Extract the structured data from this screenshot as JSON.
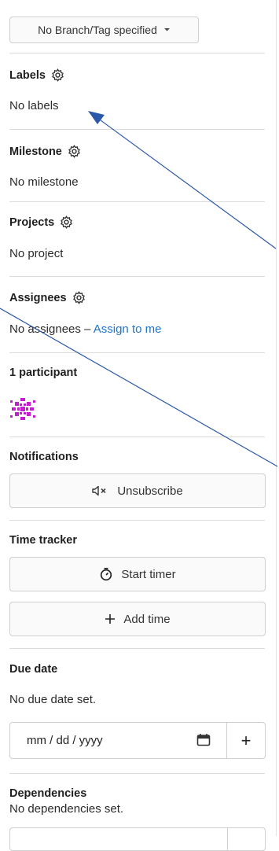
{
  "branch": {
    "label": "No Branch/Tag specified"
  },
  "labels": {
    "title": "Labels",
    "value": "No labels"
  },
  "milestone": {
    "title": "Milestone",
    "value": "No milestone"
  },
  "projects": {
    "title": "Projects",
    "value": "No project"
  },
  "assignees": {
    "title": "Assignees",
    "value": "No assignees – ",
    "assign_link": "Assign to me"
  },
  "participants": {
    "title": "1 participant"
  },
  "notifications": {
    "title": "Notifications",
    "button": "Unsubscribe"
  },
  "time_tracker": {
    "title": "Time tracker",
    "start": "Start timer",
    "add": "Add time"
  },
  "due_date": {
    "title": "Due date",
    "value": "No due date set.",
    "placeholder": "mm / dd / yyyy",
    "plus": "+"
  },
  "dependencies": {
    "title": "Dependencies",
    "value": "No dependencies set."
  },
  "colors": {
    "link": "#1f75cb",
    "avatar": "#c31ecf",
    "arrow": "#2b58a8"
  },
  "icons": [
    "gear-icon",
    "chevron-down-icon",
    "mute-icon",
    "timer-icon",
    "plus-icon",
    "calendar-icon",
    "identicon-avatar"
  ]
}
